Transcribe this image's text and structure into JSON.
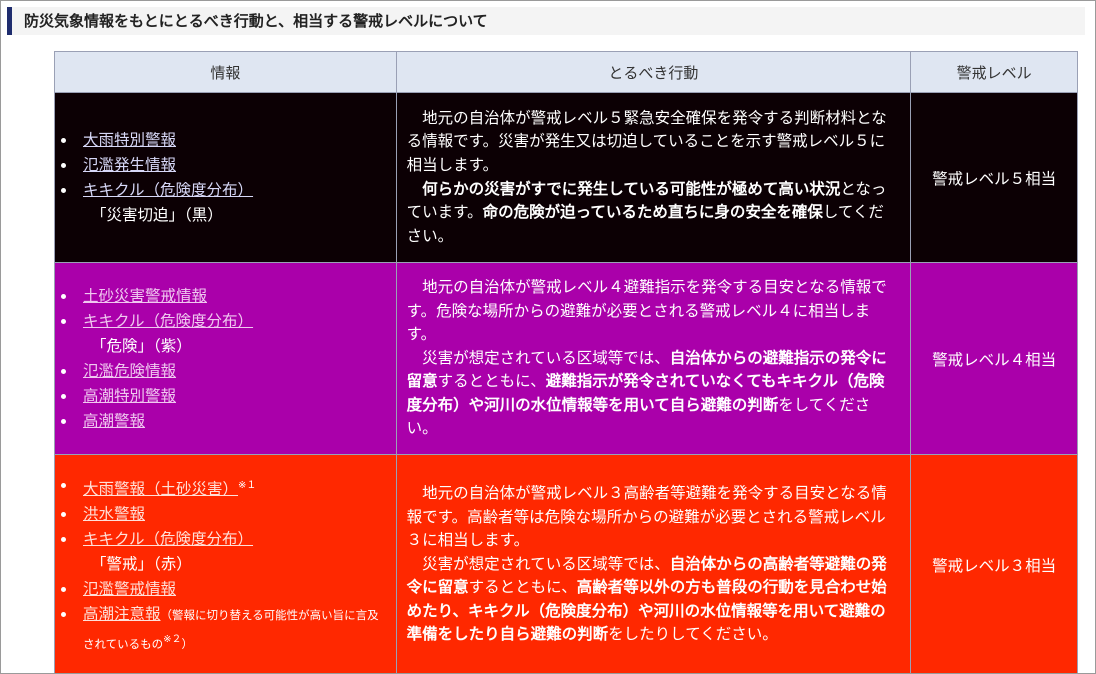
{
  "heading": "防災気象情報をもとにとるべき行動と、相当する警戒レベルについて",
  "columns": {
    "info": "情報",
    "action": "とるべき行動",
    "level": "警戒レベル"
  },
  "colors": {
    "level5": "#0c0004",
    "level4": "#aa00aa",
    "level3": "#ff2800",
    "header_bg": "#dfe6f2",
    "heading_bar": "#1f2d6e"
  },
  "rows": [
    {
      "info": {
        "link1": "大雨特別警報",
        "link2": "氾濫発生情報",
        "link3": "キキクル（危険度分布）",
        "note3": "「災害切迫」（黒）"
      },
      "action": {
        "p1": "地元の自治体が警戒レベル５緊急安全確保を発令する判断材料となる情報です。災害が発生又は切迫していることを示す警戒レベル５に相当します。",
        "p2_b1": "何らかの災害がすでに発生している可能性が極めて高い状況",
        "p2_t1": "となっています。",
        "p2_b2": "命の危険が迫っているため直ちに身の安全を確保",
        "p2_t2": "してください。"
      },
      "level": "警戒レベル５相当"
    },
    {
      "info": {
        "link1": "土砂災害警戒情報",
        "link2": "キキクル（危険度分布）",
        "note2": "「危険」（紫）",
        "link3": "氾濫危険情報",
        "link4": "高潮特別警報",
        "link5": "高潮警報"
      },
      "action": {
        "p1": "地元の自治体が警戒レベル４避難指示を発令する目安となる情報です。危険な場所からの避難が必要とされる警戒レベル４に相当します。",
        "p2_t1": "災害が想定されている区域等では、",
        "p2_b1": "自治体からの避難指示の発令に留意",
        "p2_t2": "するとともに、",
        "p2_b2": "避難指示が発令されていなくてもキキクル（危険度分布）や河川の水位情報等を用いて自ら避難の判断",
        "p2_t3": "をしてください。"
      },
      "level": "警戒レベル４相当"
    },
    {
      "info": {
        "link1": "大雨警報（土砂災害）",
        "sup1": "※１",
        "link2": "洪水警報",
        "link3": "キキクル（危険度分布）",
        "note3": "「警戒」（赤）",
        "link4": "氾濫警戒情報",
        "link5": "高潮注意報",
        "note5": "（警報に切り替える可能性が高い旨に言及されているもの",
        "sup5": "※２",
        "note5_end": "）"
      },
      "action": {
        "p1": "地元の自治体が警戒レベル３高齢者等避難を発令する目安となる情報です。高齢者等は危険な場所からの避難が必要とされる警戒レベル３に相当します。",
        "p2_t1": "災害が想定されている区域等では、",
        "p2_b1": "自治体からの高齢者等避難の発令に留意",
        "p2_t2": "するとともに、",
        "p2_b2": "高齢者等以外の方も普段の行動を見合わせ始めたり、キキクル（危険度分布）や河川の水位情報等を用いて避難の準備をしたり自ら避難の判断",
        "p2_t3": "をしたりしてください。"
      },
      "level": "警戒レベル３相当"
    }
  ]
}
